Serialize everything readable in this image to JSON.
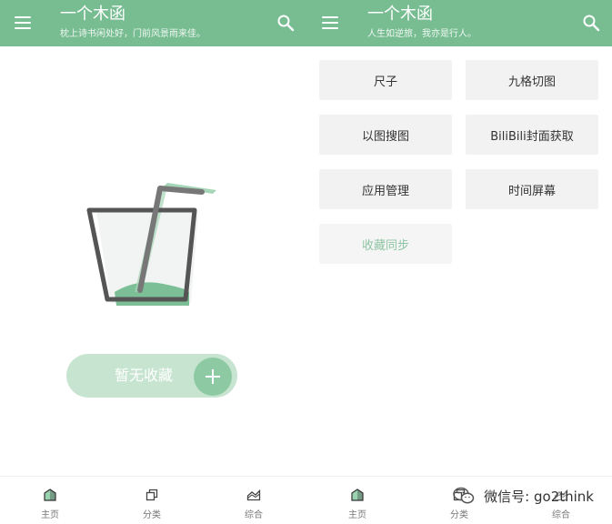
{
  "left_screen": {
    "appbar": {
      "title": "一个木函",
      "subtitle": "枕上诗书闲处好，门前风景雨来佳。",
      "menu_icon": "menu-icon",
      "search_icon": "search-icon"
    },
    "empty_state": {
      "illustration": "empty-cup-illustration",
      "label": "暂无收藏",
      "add_icon": "plus-icon"
    },
    "bottom_nav": [
      {
        "label": "主页",
        "icon": "home-icon"
      },
      {
        "label": "分类",
        "icon": "category-icon"
      },
      {
        "label": "综合",
        "icon": "landscape-icon"
      }
    ]
  },
  "right_screen": {
    "appbar": {
      "title": "一个木函",
      "subtitle": "人生如逆旅，我亦是行人。",
      "menu_icon": "menu-icon",
      "search_icon": "search-icon"
    },
    "tools": [
      {
        "label": "尺子",
        "enabled": true
      },
      {
        "label": "九格切图",
        "enabled": true
      },
      {
        "label": "以图搜图",
        "enabled": true
      },
      {
        "label": "BiliBili封面获取",
        "enabled": true
      },
      {
        "label": "应用管理",
        "enabled": true
      },
      {
        "label": "时间屏幕",
        "enabled": true
      },
      {
        "label": "收藏同步",
        "enabled": false
      }
    ],
    "bottom_nav": [
      {
        "label": "主页",
        "icon": "home-icon"
      },
      {
        "label": "分类",
        "icon": "category-icon"
      },
      {
        "label": "综合",
        "icon": "landscape-icon"
      }
    ]
  },
  "watermark": {
    "text": "微信号: go2think",
    "icon": "wechat-icon"
  },
  "colors": {
    "primary": "#78bd92",
    "accent_light": "#c7e4d1",
    "fab": "#8dcaa4",
    "button_bg": "#f2f2f2"
  }
}
